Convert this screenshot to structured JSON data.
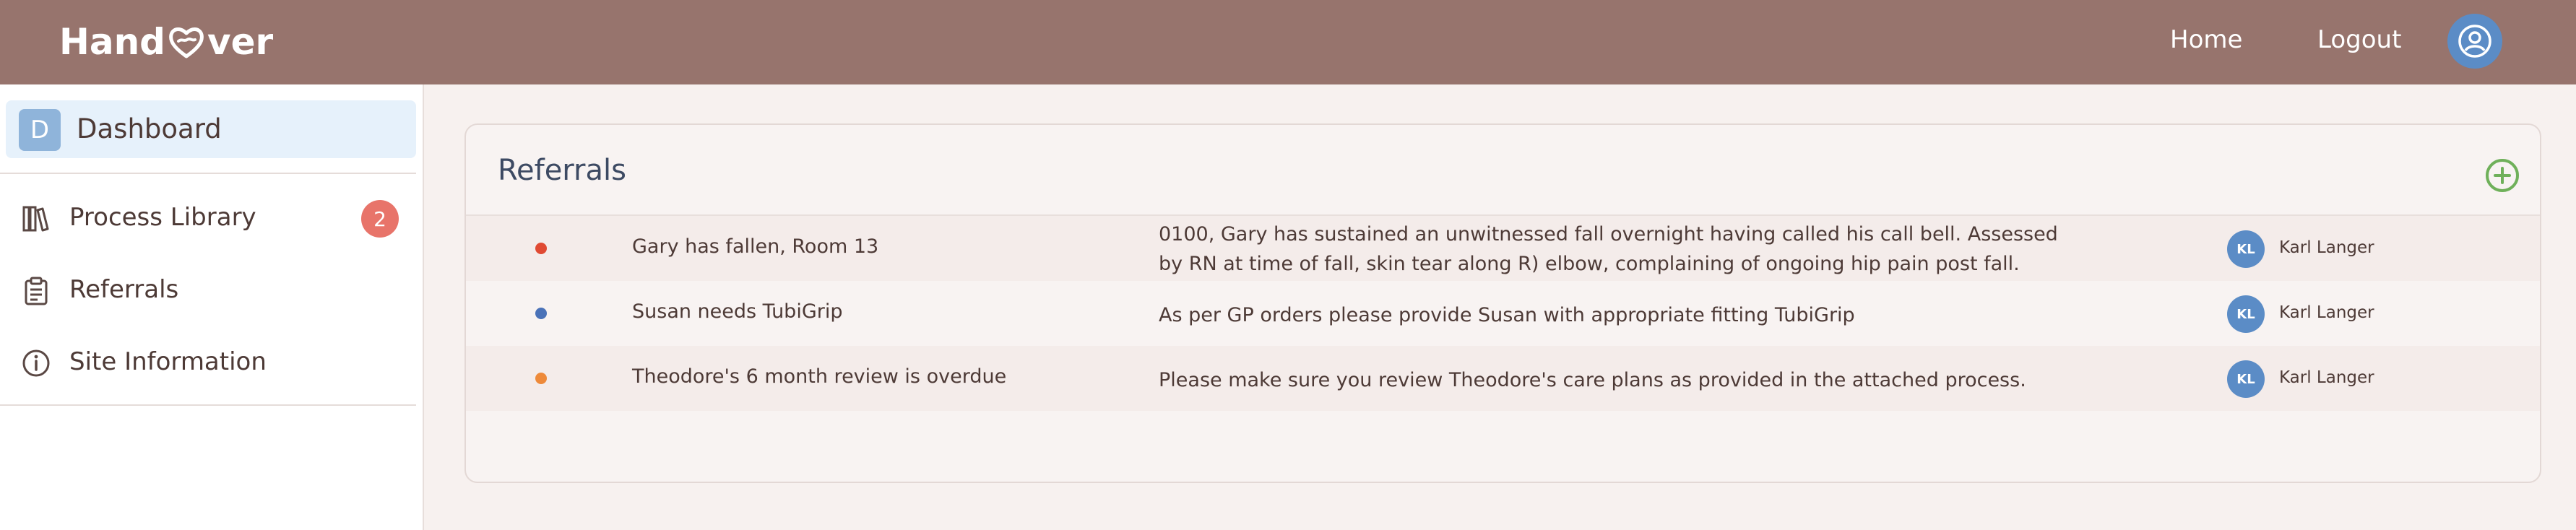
{
  "app": {
    "logo_left": "Hand",
    "logo_right": "ver"
  },
  "header": {
    "nav": [
      "Home",
      "Logout"
    ]
  },
  "sidebar": {
    "dashboard": {
      "letter": "D",
      "label": "Dashboard"
    },
    "items": [
      {
        "label": "Process Library",
        "icon": "books-icon",
        "badge": "2"
      },
      {
        "label": "Referrals",
        "icon": "clipboard-icon"
      },
      {
        "label": "Site Information",
        "icon": "info-icon"
      }
    ]
  },
  "main": {
    "title": "Referrals",
    "rows": [
      {
        "status_color": "#e04a33",
        "title": "Gary has fallen, Room 13",
        "description": "0100, Gary has sustained an unwitnessed fall overnight having called his call bell. Assessed by RN at time of fall, skin tear along R) elbow, complaining of ongoing hip pain post fall.",
        "assignee_initials": "KL",
        "assignee_name": "Karl Langer"
      },
      {
        "status_color": "#4a72b8",
        "title": "Susan needs TubiGrip",
        "description": "As per GP orders please provide Susan with appropriate fitting TubiGrip",
        "assignee_initials": "KL",
        "assignee_name": "Karl Langer"
      },
      {
        "status_color": "#ee8a3a",
        "title": "Theodore's 6 month review is overdue",
        "description": "Please make sure you review Theodore's care plans as provided in the attached process.",
        "assignee_initials": "KL",
        "assignee_name": "Karl Langer"
      }
    ]
  },
  "colors": {
    "header_bg": "#97746d",
    "accent_blue": "#5b8cc6",
    "add_green": "#6fb05a",
    "badge_red": "#e8746a"
  }
}
